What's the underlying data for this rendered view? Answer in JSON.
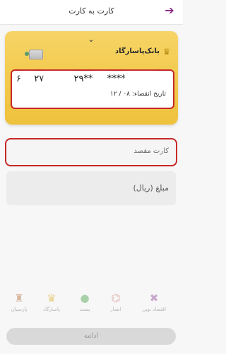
{
  "header": {
    "title": "کارت به کارت"
  },
  "card": {
    "bank_name": "بانک‌پاسارگاد",
    "number_visible": [
      "۶",
      "۲۷",
      "۲۹**",
      "****"
    ],
    "expiry_label": "تاریخ انقضاء:",
    "expiry_value": "۰۸ / ۱۲"
  },
  "form": {
    "destination_placeholder": "کارت مقصد",
    "amount_placeholder": "مبلغ (ریال)"
  },
  "banks": [
    {
      "name": "اقتصاد نوین"
    },
    {
      "name": "انصار"
    },
    {
      "name": "پست"
    },
    {
      "name": "پاسارگاد"
    },
    {
      "name": "پارسیان"
    }
  ],
  "actions": {
    "continue_label": "ادامه"
  },
  "colors": {
    "accent": "#8a2a86",
    "card_gold": "#f2c94c",
    "highlight_red": "#c62828",
    "disabled_button": "#d9d9d9"
  }
}
